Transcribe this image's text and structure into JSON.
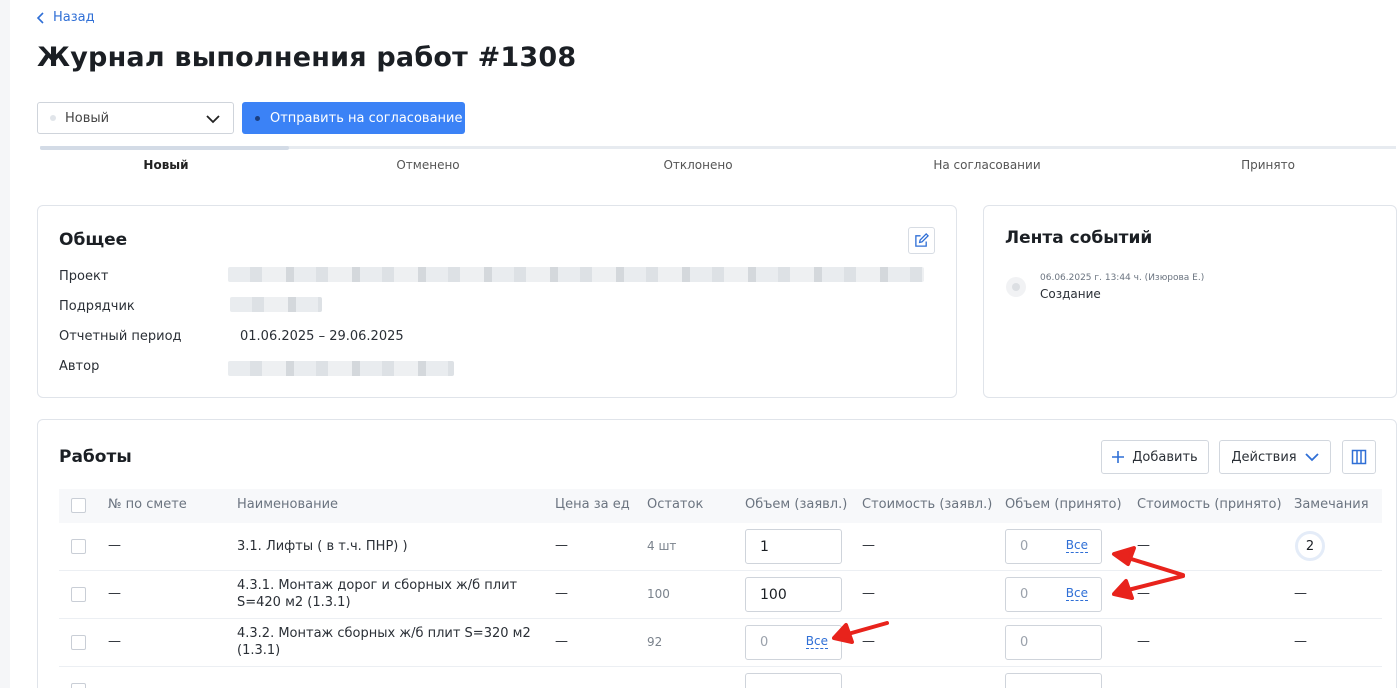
{
  "back_label": "Назад",
  "title": "Журнал выполнения работ #1308",
  "status": {
    "value": "Новый"
  },
  "send_button": "Отправить на согласование",
  "steps": [
    "Новый",
    "Отменено",
    "Отклонено",
    "На согласовании",
    "Принято"
  ],
  "general": {
    "title": "Общее",
    "fields": [
      {
        "label": "Проект",
        "value": null,
        "redacted": true
      },
      {
        "label": "Подрядчик",
        "value": null,
        "redacted": true
      },
      {
        "label": "Отчетный период",
        "value": "01.06.2025 – 29.06.2025",
        "redacted": false
      },
      {
        "label": "Автор",
        "value": null,
        "redacted": true
      }
    ]
  },
  "events": {
    "title": "Лента событий",
    "items": [
      {
        "meta": "06.06.2025 г. 13:44 ч. (Изюрова Е.)",
        "text": "Создание"
      }
    ]
  },
  "works": {
    "title": "Работы",
    "add_button": "Добавить",
    "actions_button": "Действия",
    "columns": [
      "№ по смете",
      "Наименование",
      "Цена за ед",
      "Остаток",
      "Объем (заявл.)",
      "Стоимость (заявл.)",
      "Объем (принято)",
      "Стоимость (принято)",
      "Замечания"
    ],
    "rows": [
      {
        "num": "—",
        "name": "3.1. Лифты ( в т.ч. ПНР) )",
        "price": "—",
        "remain": "4 шт",
        "vol_decl": "1",
        "cost_decl": "—",
        "vol_acc_placeholder": "0",
        "vol_acc_all": "Все",
        "cost_acc": "—",
        "remarks": "2"
      },
      {
        "num": "—",
        "name": "4.3.1. Монтаж дорог и сборных ж/б плит S=420 м2 (1.3.1)",
        "price": "—",
        "remain": "100",
        "vol_decl": "100",
        "cost_decl": "—",
        "vol_acc_placeholder": "0",
        "vol_acc_all": "Все",
        "cost_acc": "—",
        "remarks": "—"
      },
      {
        "num": "—",
        "name": "4.3.2. Монтаж сборных ж/б плит S=320 м2 (1.3.1)",
        "price": "—",
        "remain": "92",
        "vol_decl_placeholder": "0",
        "vol_decl_all": "Все",
        "cost_decl": "—",
        "vol_acc_placeholder": "0",
        "cost_acc": "—",
        "remarks": "—"
      }
    ]
  },
  "colors": {
    "accent": "#3b82f6",
    "link": "#2f6fd6",
    "annotation": "#e8231c"
  },
  "annotations": {
    "type": "red-arrow",
    "count": 3
  }
}
